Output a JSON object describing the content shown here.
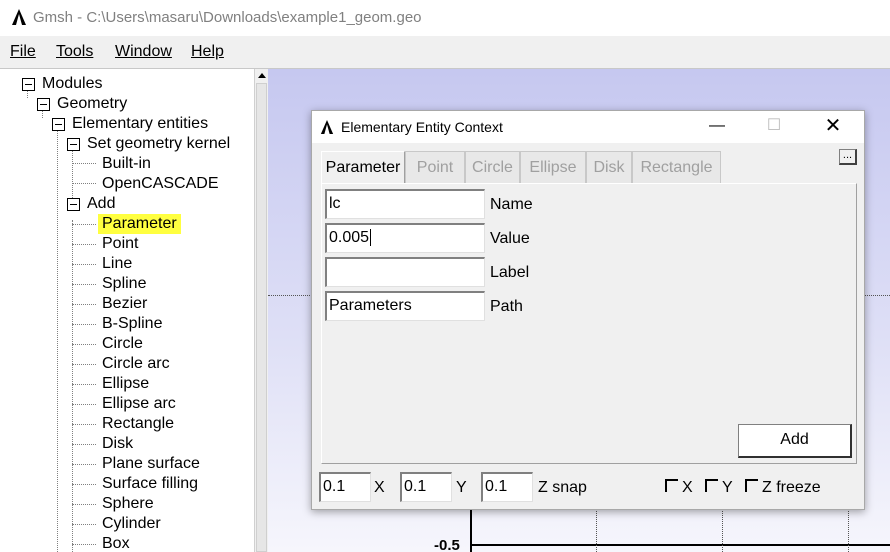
{
  "window": {
    "title": "Gmsh - C:\\Users\\masaru\\Downloads\\example1_geom.geo"
  },
  "menu": [
    "File",
    "Tools",
    "Window",
    "Help"
  ],
  "tree": {
    "modules": "Modules",
    "geometry": "Geometry",
    "elementary": "Elementary entities",
    "kernel": "Set geometry kernel",
    "builtin": "Built-in",
    "occ": "OpenCASCADE",
    "add": "Add",
    "add_items": [
      "Parameter",
      "Point",
      "Line",
      "Spline",
      "Bezier",
      "B-Spline",
      "Circle",
      "Circle arc",
      "Ellipse",
      "Ellipse arc",
      "Rectangle",
      "Disk",
      "Plane surface",
      "Surface filling",
      "Sphere",
      "Cylinder",
      "Box"
    ],
    "selected": "Parameter"
  },
  "canvas": {
    "y_tick": "-0.5"
  },
  "dialog": {
    "title": "Elementary Entity Context",
    "tabs": [
      "Parameter",
      "Point",
      "Circle",
      "Ellipse",
      "Disk",
      "Rectangle"
    ],
    "active_tab": "Parameter",
    "more_button": "...",
    "fields": [
      {
        "value": "lc",
        "label": "Name"
      },
      {
        "value": "0.005",
        "label": "Value"
      },
      {
        "value": "",
        "label": "Label"
      },
      {
        "value": "Parameters",
        "label": "Path"
      }
    ],
    "add_button": "Add",
    "snap": [
      {
        "value": "0.1",
        "label": "X"
      },
      {
        "value": "0.1",
        "label": "Y"
      },
      {
        "value": "0.1",
        "label": "Z snap"
      }
    ],
    "freeze": [
      "X",
      "Y",
      "Z freeze"
    ]
  },
  "colors": {
    "highlight": "#ffff40",
    "canvas_top": "#c6c8f0",
    "canvas_bottom": "#f6f6fc"
  }
}
